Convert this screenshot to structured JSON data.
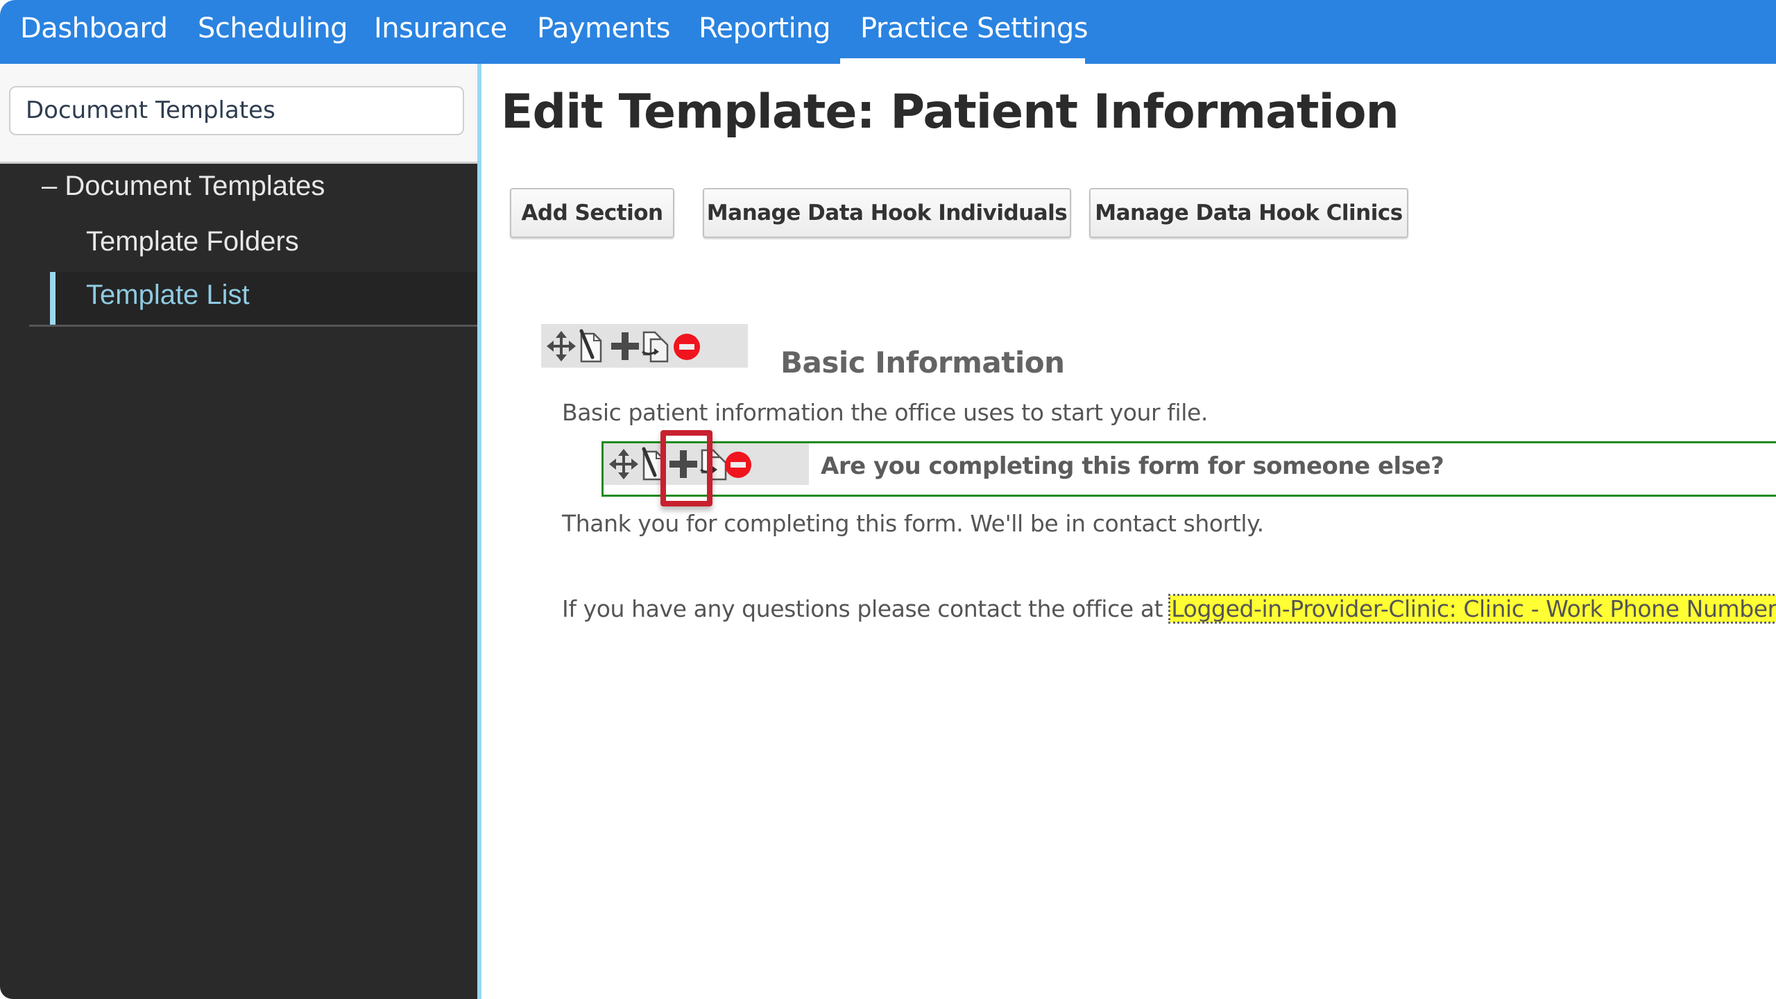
{
  "topnav": {
    "items": [
      {
        "label": "Dashboard"
      },
      {
        "label": "Scheduling"
      },
      {
        "label": "Insurance"
      },
      {
        "label": "Payments"
      },
      {
        "label": "Reporting"
      },
      {
        "label": "Practice Settings",
        "active": true
      }
    ]
  },
  "sidebar": {
    "search_value": "Document Templates",
    "tree": {
      "parent": {
        "toggle": "–",
        "label": "Document Templates"
      },
      "children": [
        {
          "label": "Template Folders"
        },
        {
          "label": "Template List",
          "active": true
        }
      ]
    }
  },
  "main": {
    "title": "Edit Template: Patient Information",
    "buttons": {
      "add_section": "Add Section",
      "manage_individuals": "Manage Data Hook Individuals",
      "manage_clinics": "Manage Data Hook Clinics"
    },
    "section": {
      "heading": "Basic Information",
      "description": "Basic patient information the office uses to start your file.",
      "toolbar_icons": [
        "move-icon",
        "edit-document-icon",
        "add-icon",
        "copy-document-icon",
        "delete-icon"
      ],
      "question": {
        "text": "Are you completing this form for someone else?",
        "toolbar_icons": [
          "move-icon",
          "edit-document-icon",
          "add-icon",
          "copy-document-icon",
          "delete-icon"
        ],
        "highlighted_icon": "add-icon"
      },
      "thank_you": "Thank you for completing this form. We'll be in contact shortly.",
      "contact_prefix": "If you have any questions please contact the office at ",
      "data_hook": "Logged-in-Provider-Clinic: Clinic - Work Phone Number"
    }
  },
  "colors": {
    "nav_blue": "#2a83e0",
    "sidebar_dark": "#2a2a2a",
    "sidebar_accent": "#9ad8f0",
    "question_border": "#1f8a1f",
    "highlight_red": "#c8202e",
    "delete_red": "#f0141e",
    "data_hook_yellow": "#ffff33"
  }
}
